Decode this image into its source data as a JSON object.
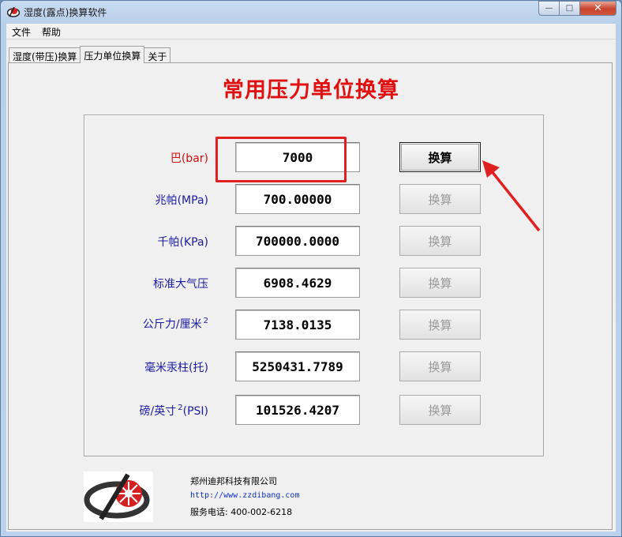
{
  "window": {
    "title": "湿度(露点)换算软件",
    "controls": {
      "minimize": "—",
      "maximize": "□",
      "close": "✕"
    }
  },
  "menu": [
    "文件",
    "帮助"
  ],
  "tabs": [
    {
      "label": "湿度(带压)换算",
      "active": false
    },
    {
      "label": "压力单位换算",
      "active": true
    },
    {
      "label": "关于",
      "active": false
    }
  ],
  "page": {
    "title": "常用压力单位换算",
    "convert_label": "换算",
    "rows": [
      {
        "label": "巴(bar)",
        "value": "7000",
        "enabled": true
      },
      {
        "label": "兆帕(MPa)",
        "value": "700.00000",
        "enabled": false
      },
      {
        "label": "千帕(KPa)",
        "value": "700000.0000",
        "enabled": false
      },
      {
        "label": "标准大气压",
        "value": "6908.4629",
        "enabled": false
      },
      {
        "label": "公斤力/厘米",
        "sup": "2",
        "value": "7138.0135",
        "enabled": false
      },
      {
        "label": "毫米汞柱(托)",
        "value": "5250431.7789",
        "enabled": false
      },
      {
        "label": "磅/英寸",
        "sup": "2",
        "label_suffix": "(PSI)",
        "value": "101526.4207",
        "enabled": false
      }
    ]
  },
  "footer": {
    "company": "郑州迪邦科技有限公司",
    "url": "http://www.zzdibang.com",
    "phone": "服务电话: 400-002-6218"
  },
  "colors": {
    "title_red": "#e01010",
    "label_blue": "#1a1aa0",
    "label_red": "#d01010",
    "annotation_red": "#e02020"
  },
  "icons": {
    "app": "dibang-logo-icon",
    "annotation": "red-arrow-icon"
  }
}
